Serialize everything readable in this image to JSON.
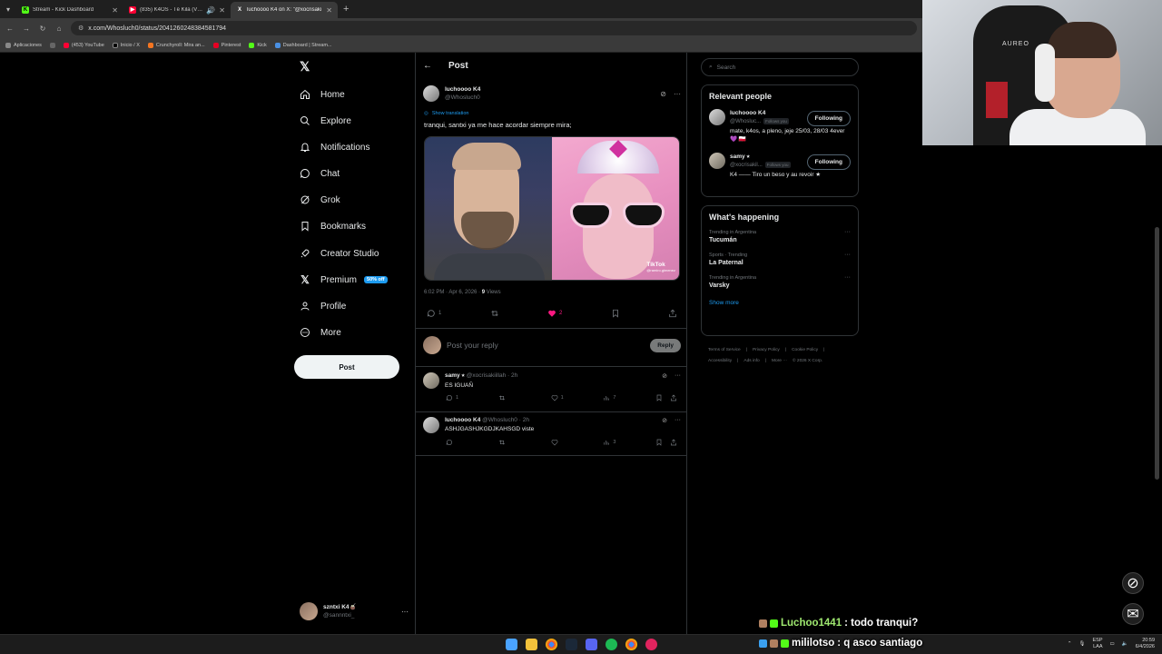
{
  "browser": {
    "tabs": [
      {
        "label": "Stream - Kick Dashboard",
        "color": "#53fc18",
        "glyph": "K"
      },
      {
        "label": "(835) K4OS - Të Kila (Video",
        "color": "#ff0033",
        "glyph": "▶"
      },
      {
        "label": "luchoooo K4 on X: \"@xocrisaki",
        "color": "#000000",
        "glyph": "X"
      }
    ],
    "url": "x.com/Whosluch0/status/2041260248384581794",
    "bookmarks": [
      {
        "label": "Aplicaciones",
        "color": "#888888"
      },
      {
        "label": "(453) YouTube",
        "color": "#ff0033"
      },
      {
        "label": "Inicio / X",
        "color": "#000000"
      },
      {
        "label": "Crunchyroll: Mira an...",
        "color": "#f47521"
      },
      {
        "label": "Pinterest",
        "color": "#e60023"
      },
      {
        "label": "Kick",
        "color": "#53fc18"
      },
      {
        "label": "Dashboard | Stream...",
        "color": "#4a90e2"
      }
    ]
  },
  "webcam": {
    "brand": "AUREO"
  },
  "nav": {
    "items": [
      {
        "label": "Home",
        "icon": "home-icon"
      },
      {
        "label": "Explore",
        "icon": "search-icon"
      },
      {
        "label": "Notifications",
        "icon": "bell-icon"
      },
      {
        "label": "Chat",
        "icon": "chat-icon"
      },
      {
        "label": "Grok",
        "icon": "grok-icon"
      },
      {
        "label": "Bookmarks",
        "icon": "bookmark-icon"
      },
      {
        "label": "Creator Studio",
        "icon": "rocket-icon"
      },
      {
        "label": "Premium",
        "icon": "x-icon"
      },
      {
        "label": "Profile",
        "icon": "person-icon"
      },
      {
        "label": "More",
        "icon": "more-circle-icon"
      }
    ],
    "premium_badge": "50% off",
    "post_button": "Post",
    "account": {
      "name": "szntxi K4🧉",
      "handle": "@sannntxi_"
    }
  },
  "post": {
    "header": "Post",
    "author_name": "luchoooo K4",
    "author_handle": "@Whosluch0",
    "show_translation": "Show translation",
    "text": "tranqui, santxi ya me hace acordar siempre mira;",
    "tiktok_label": "TikTok",
    "tiktok_handle": "@ramiro.gimenez",
    "time": "6:02 PM · Apr 6, 2026 · ",
    "views": "9",
    "views_label": " Views",
    "replies": "1",
    "likes": "2",
    "reply_placeholder": "Post your reply",
    "reply_button": "Reply"
  },
  "replies": [
    {
      "name": "samy ⭑",
      "handle": "@xocrisakiillah · 2h",
      "text": "ES IGUAÑ",
      "replies": "1",
      "likes": "1",
      "views": "7"
    },
    {
      "name": "luchoooo K4",
      "handle": "@Whosluch0 · 2h",
      "text": "ASHJGASHJKGDJKAHSGD viste",
      "replies": "",
      "likes": "",
      "views": "3"
    }
  ],
  "sidebar": {
    "search_placeholder": "Search",
    "relevant_title": "Relevant people",
    "people": [
      {
        "name": "luchoooo K4",
        "handle": "@Whosluc...",
        "follows": "Follows you",
        "bio": "mate, k4os, a pleno, jeje 25/03, 28/03 4ever 💜 🇵🇱",
        "button": "Following"
      },
      {
        "name": "samy ⭑",
        "handle": "@xocrisakil...",
        "follows": "Follows you",
        "bio": "K4 —— Tiro un beso y au revoir ★",
        "button": "Following"
      }
    ],
    "happening_title": "What's happening",
    "trends": [
      {
        "context": "Trending in Argentina",
        "name": "Tucumán"
      },
      {
        "context": "Sports · Trending",
        "name": "La Paternal"
      },
      {
        "context": "Trending in Argentina",
        "name": "Varsky"
      }
    ],
    "show_more": "Show more",
    "footer": [
      "Terms of Service",
      "|",
      "Privacy Policy",
      "|",
      "Cookie Policy",
      "|",
      "Accessibility",
      "|",
      "Ads info",
      "|",
      "More ···",
      "© 2026 X Corp."
    ]
  },
  "chat": [
    {
      "user": "Luchoo1441",
      "msg": ": todo tranqui?"
    },
    {
      "user": "mililotso",
      "msg": ": q asco santiago"
    }
  ],
  "taskbar": {
    "lang": "ESP",
    "lang2": "LAA",
    "time": "20:59",
    "date": "6/4/2026"
  }
}
